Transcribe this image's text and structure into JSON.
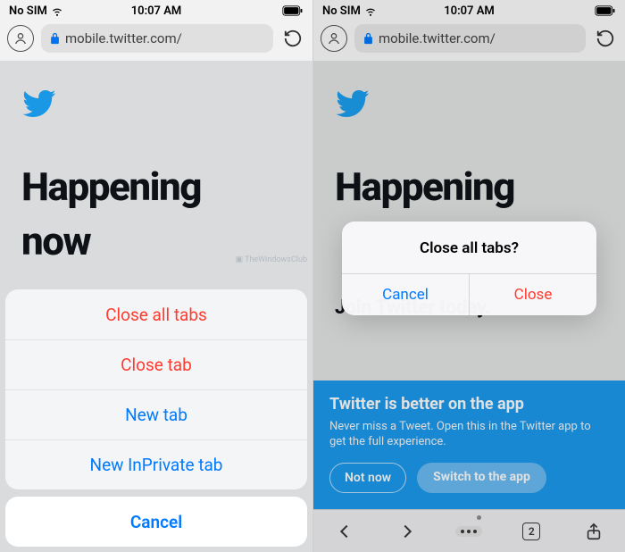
{
  "status": {
    "carrier": "No SIM",
    "time": "10:07 AM"
  },
  "address_bar": {
    "url": "mobile.twitter.com/"
  },
  "page": {
    "headline_line1": "Happening",
    "headline_line2": "now",
    "subhead": "Join Twitter today."
  },
  "app_banner": {
    "title": "Twitter is better on the app",
    "text": "Never miss a Tweet. Open this in the Twitter app to get the full experience.",
    "not_now": "Not now",
    "switch": "Switch to the app"
  },
  "action_sheet": {
    "close_all": "Close all tabs",
    "close_tab": "Close tab",
    "new_tab": "New tab",
    "new_inprivate": "New InPrivate tab",
    "cancel": "Cancel"
  },
  "alert": {
    "title": "Close all tabs?",
    "cancel": "Cancel",
    "close": "Close"
  },
  "toolbar": {
    "tab_count": "2"
  },
  "watermark": "TheWindowsClub"
}
